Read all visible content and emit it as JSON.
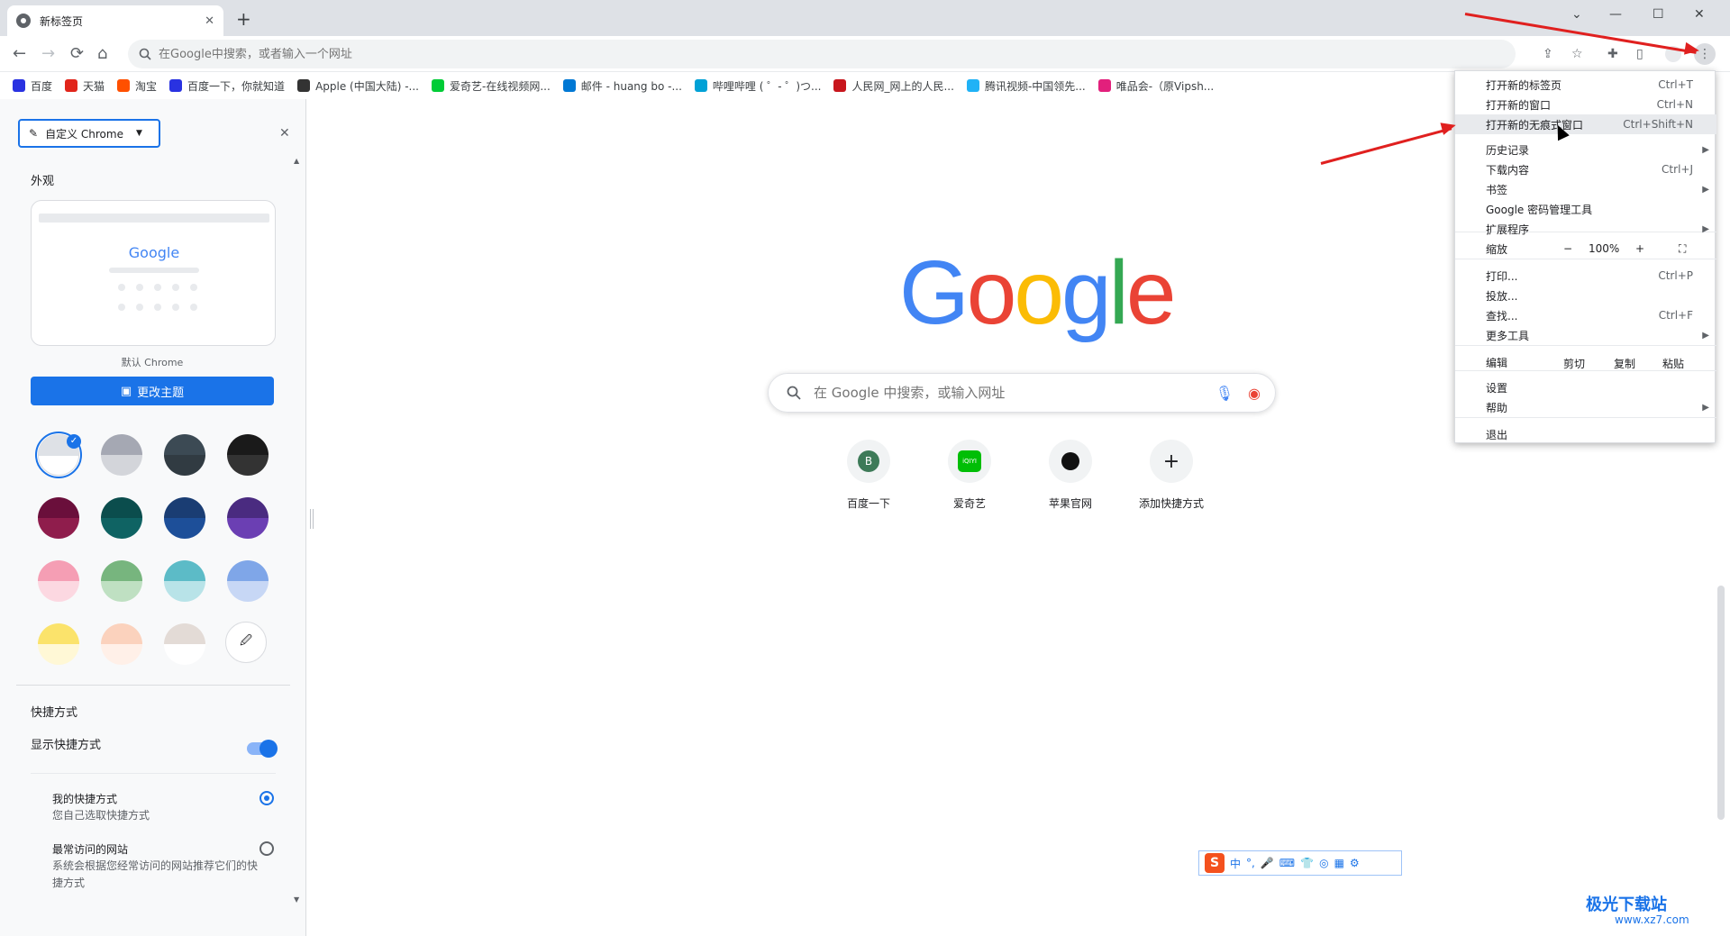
{
  "tab": {
    "title": "新标签页",
    "close": "✕",
    "new": "+"
  },
  "window": {
    "minimize": "⌄",
    "min": "—",
    "max": "☐",
    "close": "✕"
  },
  "toolbar": {
    "back": "←",
    "forward": "→",
    "reload": "⟳",
    "home": "⌂",
    "omnibox_placeholder": "在Google中搜索，或者输入一个网址"
  },
  "bookmarks": [
    {
      "label": "百度",
      "color": "#2932e1"
    },
    {
      "label": "天猫",
      "color": "#e1251b"
    },
    {
      "label": "淘宝",
      "color": "#ff5000"
    },
    {
      "label": "百度一下，你就知道",
      "color": "#2932e1"
    },
    {
      "label": "Apple (中国大陆) -...",
      "color": "#333333"
    },
    {
      "label": "爱奇艺-在线视频网...",
      "color": "#00cc36"
    },
    {
      "label": "邮件 - huang bo -...",
      "color": "#0078d4"
    },
    {
      "label": "哔哩哔哩 ( ゜- ゜)つ...",
      "color": "#00a1d6"
    },
    {
      "label": "人民网_网上的人民...",
      "color": "#c8161d"
    },
    {
      "label": "腾讯视频-中国领先...",
      "color": "#20b2f6"
    },
    {
      "label": "唯品会-（原Vipsh...",
      "color": "#e2207c"
    }
  ],
  "side_panel": {
    "header": "自定义 Chrome",
    "close": "✕",
    "appearance": "外观",
    "preview_logo": "Google",
    "preview_caption": "默认 Chrome",
    "change_theme": "更改主题",
    "shortcuts_title": "快捷方式",
    "show_shortcuts": "显示快捷方式",
    "show_shortcuts_on": true,
    "my_shortcuts": "我的快捷方式",
    "my_shortcuts_desc": "您自己选取快捷方式",
    "most_visited": "最常访问的网站",
    "most_visited_desc": "系统会根据您经常访问的网站推荐它们的快捷方式",
    "swatches": [
      [
        "#dee1e6",
        "#ffffff"
      ],
      [
        "#a5a8b3",
        "#d3d5da"
      ],
      [
        "#3c4a54",
        "#313b42"
      ],
      [
        "#1a1a1a",
        "#333333"
      ],
      [
        "#6a0f3b",
        "#8f1d4c"
      ],
      [
        "#0b4d4d",
        "#0f6363"
      ],
      [
        "#1a3d73",
        "#1d4f99"
      ],
      [
        "#4a2b80",
        "#6b3fb3"
      ],
      [
        "#f59eb4",
        "#fcd8e1"
      ],
      [
        "#77b57e",
        "#bfe0c2"
      ],
      [
        "#5cbbc7",
        "#b8e3e8"
      ],
      [
        "#7fa6e8",
        "#c7d7f5"
      ],
      [
        "#fbe36b",
        "#fff8d6"
      ],
      [
        "#fbd2bd",
        "#fff0e8"
      ],
      [
        "#e3dbd6",
        "#ffffff"
      ]
    ]
  },
  "ntp": {
    "search_placeholder": "在 Google 中搜索，或输入网址",
    "shortcuts": [
      {
        "label": "百度一下",
        "glyph": "B"
      },
      {
        "label": "爱奇艺",
        "glyph": "iQIYI"
      },
      {
        "label": "苹果官网",
        "glyph": ""
      },
      {
        "label": "添加快捷方式",
        "glyph": "+"
      }
    ]
  },
  "menu": {
    "items": [
      {
        "label": "打开新的标签页",
        "shortcut": "Ctrl+T"
      },
      {
        "label": "打开新的窗口",
        "shortcut": "Ctrl+N"
      },
      {
        "label": "打开新的无痕式窗口",
        "shortcut": "Ctrl+Shift+N"
      },
      {
        "label": "历史记录",
        "shortcut": ""
      },
      {
        "label": "下载内容",
        "shortcut": "Ctrl+J"
      },
      {
        "label": "书签",
        "shortcut": ""
      },
      {
        "label": "Google 密码管理工具",
        "shortcut": ""
      },
      {
        "label": "扩展程序",
        "shortcut": ""
      },
      {
        "label": "缩放",
        "shortcut": ""
      },
      {
        "label": "打印...",
        "shortcut": "Ctrl+P"
      },
      {
        "label": "投放...",
        "shortcut": ""
      },
      {
        "label": "查找...",
        "shortcut": "Ctrl+F"
      },
      {
        "label": "更多工具",
        "shortcut": ""
      },
      {
        "label": "编辑",
        "shortcut": ""
      },
      {
        "label": "设置",
        "shortcut": ""
      },
      {
        "label": "帮助",
        "shortcut": ""
      },
      {
        "label": "退出",
        "shortcut": ""
      }
    ],
    "zoom": {
      "minus": "−",
      "value": "100%",
      "plus": "+",
      "fullscreen": "⛶"
    },
    "edit": {
      "cut": "剪切",
      "copy": "复制",
      "paste": "粘贴"
    }
  },
  "ime": {
    "lang": "中",
    "punct": "°,",
    "logo": "S"
  },
  "watermark": {
    "brand": "极光下载站",
    "url": "www.xz7.com"
  }
}
